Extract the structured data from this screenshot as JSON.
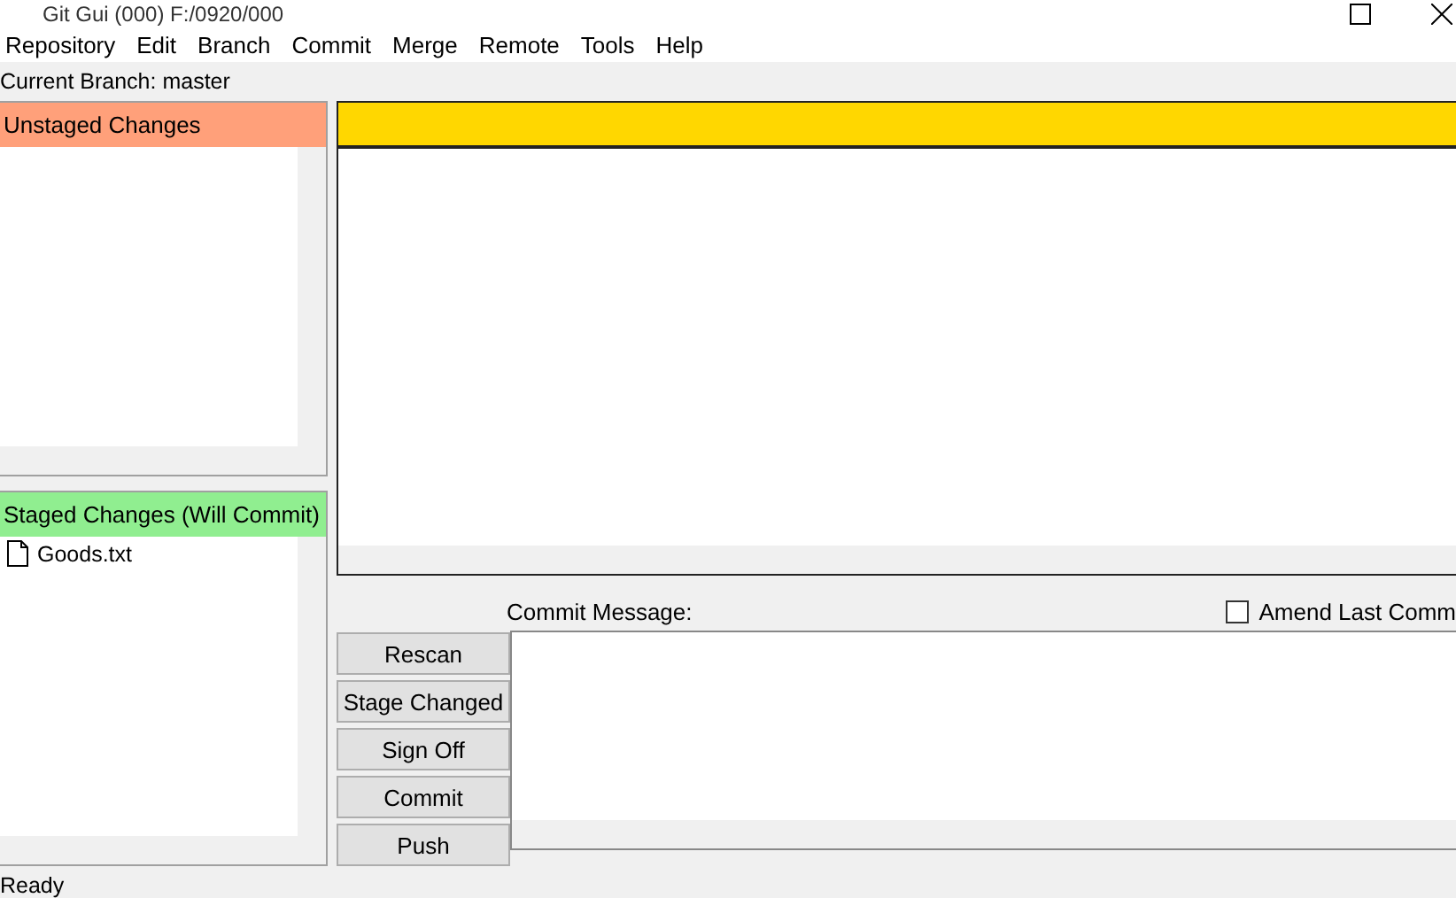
{
  "window": {
    "title": "Git Gui (000) F:/0920/000"
  },
  "menu": [
    "Repository",
    "Edit",
    "Branch",
    "Commit",
    "Merge",
    "Remote",
    "Tools",
    "Help"
  ],
  "branch_label": "Current Branch: master",
  "unstaged": {
    "title": "Unstaged Changes"
  },
  "staged": {
    "title": "Staged Changes (Will Commit)",
    "files": [
      {
        "name": "Goods.txt"
      }
    ]
  },
  "commit": {
    "label": "Commit Message:",
    "amend": {
      "label": "Amend Last Comm",
      "checked": false
    }
  },
  "buttons": [
    "Rescan",
    "Stage Changed",
    "Sign Off",
    "Commit",
    "Push"
  ],
  "status_bar": "Ready"
}
